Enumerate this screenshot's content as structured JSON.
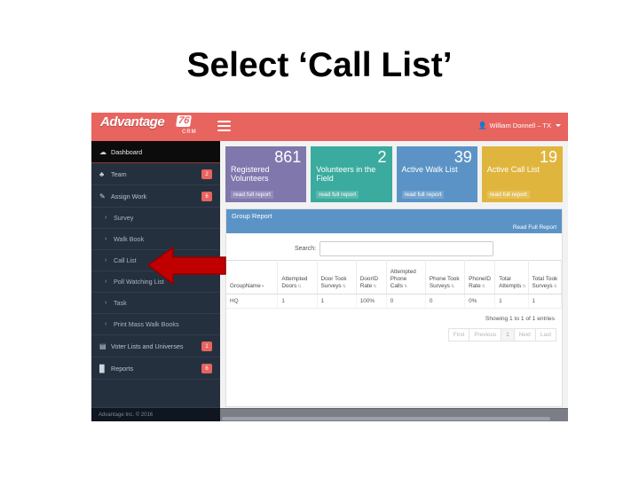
{
  "slide": {
    "title": "Select ‘Call List’"
  },
  "app": {
    "navbar": {
      "brand_main": "Advantage",
      "brand_badge": "76",
      "brand_sub": "CRM",
      "menu_icon": "hamburger-icon",
      "user_icon": "user-icon",
      "user_label": "William Donnell – TX"
    },
    "sidebar": {
      "items": [
        {
          "label": "Dashboard",
          "icon": "dashboard-icon",
          "badge": "",
          "active": true,
          "sub": false
        },
        {
          "label": "Team",
          "icon": "team-icon",
          "badge": "2",
          "active": false,
          "sub": false
        },
        {
          "label": "Assign Work",
          "icon": "pencil-icon",
          "badge": "6",
          "active": false,
          "sub": false
        },
        {
          "label": "Survey",
          "icon": "chevron-right-icon",
          "badge": "",
          "active": false,
          "sub": true
        },
        {
          "label": "Walk Book",
          "icon": "chevron-right-icon",
          "badge": "",
          "active": false,
          "sub": true
        },
        {
          "label": "Call List",
          "icon": "chevron-right-icon",
          "badge": "",
          "active": false,
          "sub": true
        },
        {
          "label": "Poll Watching List",
          "icon": "chevron-right-icon",
          "badge": "",
          "active": false,
          "sub": true
        },
        {
          "label": "Task",
          "icon": "chevron-right-icon",
          "badge": "",
          "active": false,
          "sub": true
        },
        {
          "label": "Print Mass Walk Books",
          "icon": "chevron-right-icon",
          "badge": "",
          "active": false,
          "sub": true
        },
        {
          "label": "Voter Lists and Universes",
          "icon": "list-icon",
          "badge": "1",
          "active": false,
          "sub": false
        },
        {
          "label": "Reports",
          "icon": "chart-icon",
          "badge": "6",
          "active": false,
          "sub": false
        }
      ],
      "footer": "Advantage Inc. © 2016"
    },
    "cards": [
      {
        "value": "861",
        "title": "Registered Volunteers",
        "link": "read full report",
        "color": "#8077ad"
      },
      {
        "value": "2",
        "title": "Volunteers in the Field",
        "link": "read full report",
        "color": "#3aab9e"
      },
      {
        "value": "39",
        "title": "Active Walk List",
        "link": "read full report",
        "color": "#5b93c6"
      },
      {
        "value": "19",
        "title": "Active Call List",
        "link": "read full report",
        "color": "#e0b53d"
      }
    ],
    "panel": {
      "title": "Group Report",
      "link": "Read Full Report",
      "search_label": "Search:",
      "search_value": "",
      "search_placeholder": "",
      "table": {
        "columns": [
          "GroupName",
          "Attempted Doors",
          "Door Took Surveys",
          "DoorID Rate",
          "Attempted Phone Calls",
          "Phone Took Surveys",
          "PhoneID Rate",
          "Total Attempts",
          "Total Took Surveys"
        ],
        "rows": [
          [
            "HQ",
            "1",
            "1",
            "100%",
            "0",
            "0",
            "0%",
            "1",
            "1"
          ]
        ]
      },
      "showing": "Showing 1 to 1 of 1 entries",
      "pager": [
        "First",
        "Previous",
        "1",
        "Next",
        "Last"
      ]
    }
  },
  "annotation": {
    "arrow_color": "#c00000",
    "arrow_points_at": "Call List"
  }
}
